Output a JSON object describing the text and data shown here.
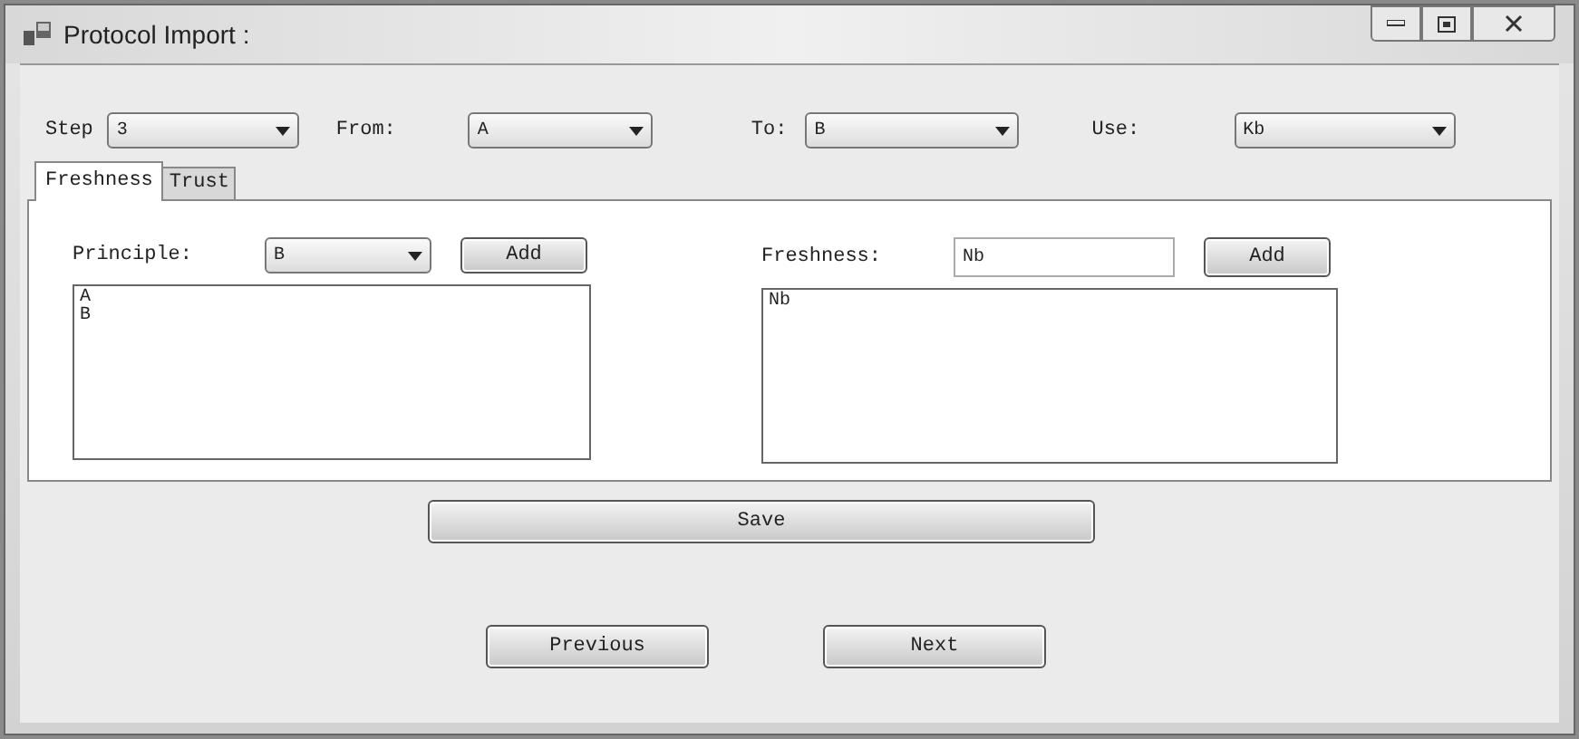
{
  "window": {
    "title": "Protocol Import :"
  },
  "selectors": [
    {
      "label": "Step",
      "value": "3"
    },
    {
      "label": "From:",
      "value": "A"
    },
    {
      "label": "To:",
      "value": "B"
    },
    {
      "label": "Use:",
      "value": "Kb"
    }
  ],
  "tabs": [
    {
      "label": "Freshness",
      "selected": true
    },
    {
      "label": "Trust",
      "selected": false
    }
  ],
  "principle": {
    "label": "Principle:",
    "value": "B",
    "button": "Add",
    "items": [
      "A",
      "B"
    ]
  },
  "freshness": {
    "label": "Freshness:",
    "value": "Nb",
    "button": "Add",
    "items": [
      "Nb"
    ]
  },
  "save_button": "Save",
  "nav_buttons": [
    "Previous",
    "Next"
  ]
}
